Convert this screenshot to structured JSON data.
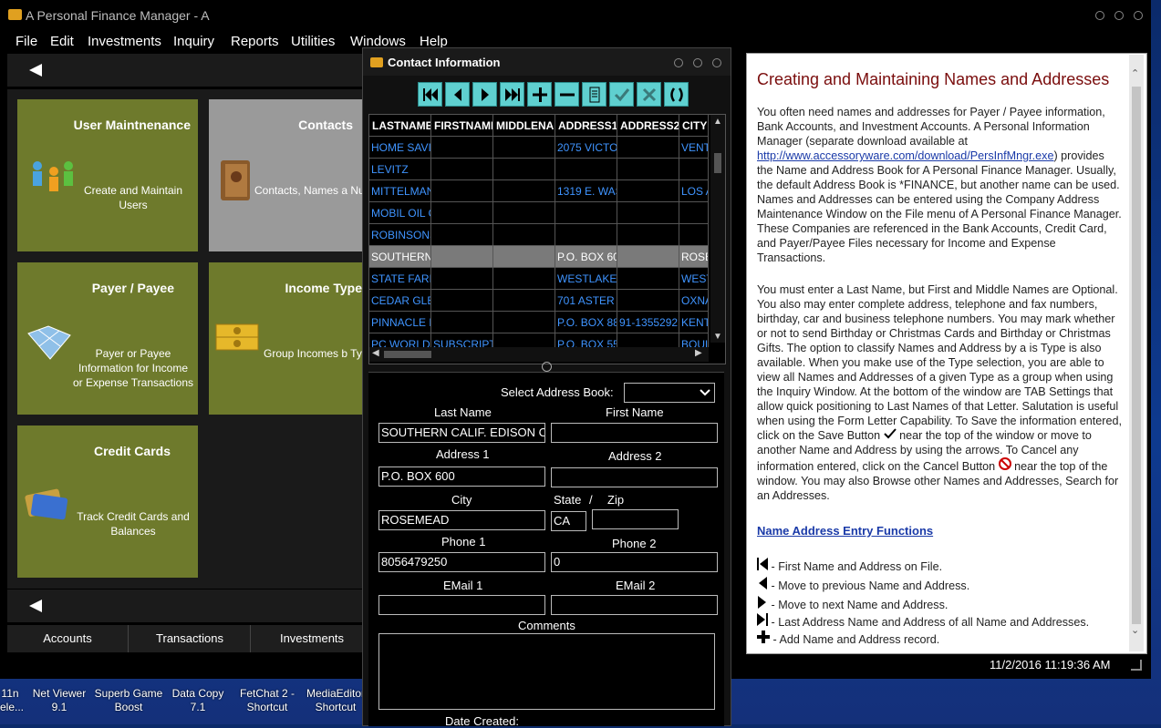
{
  "window": {
    "title": "A Personal Finance Manager - A"
  },
  "menu": [
    "File",
    "Edit",
    "Investments",
    "Inquiry",
    "Reports",
    "Utilities",
    "Windows",
    "Help"
  ],
  "tiles": [
    {
      "title": "User Maintnenance",
      "desc": "Create and Maintain Users",
      "icon": "users-icon"
    },
    {
      "title": "Contacts",
      "desc": "Contacts, Names a Numbers",
      "icon": "address-book-icon"
    },
    {
      "title": "Payer / Payee",
      "desc": "Payer or Payee Information for Income or Expense Transactions",
      "icon": "map-icon"
    },
    {
      "title": "Income Type",
      "desc": "Group Incomes b Types Created He",
      "icon": "money-icon"
    },
    {
      "title": "Credit Cards",
      "desc": "Track Credit Cards and Balances",
      "icon": "credit-card-icon"
    }
  ],
  "bottom_tabs": [
    "Accounts",
    "Transactions",
    "Investments"
  ],
  "status": {
    "datetime": "11/2/2016 11:19:36 AM"
  },
  "dialog": {
    "title": "Contact Information",
    "toolbar": [
      "first-record",
      "previous-record",
      "next-record",
      "last-record",
      "add-record",
      "delete-record",
      "print",
      "save",
      "cancel",
      "refresh"
    ],
    "grid": {
      "columns": [
        "LASTNAME",
        "FIRSTNAME",
        "MIDDLENAME",
        "ADDRESS1",
        "ADDRESS2",
        "CITY"
      ],
      "rows": [
        [
          "HOME SAVII",
          "",
          "",
          "2075 VICTOI",
          "",
          "VENT"
        ],
        [
          "LEVITZ",
          "",
          "",
          "",
          "",
          ""
        ],
        [
          "MITTELMAN",
          "",
          "",
          "1319 E. WAS",
          "",
          "LOS A"
        ],
        [
          "MOBIL OIL C",
          "",
          "",
          "",
          "",
          ""
        ],
        [
          "ROBINSONS",
          "",
          "",
          "",
          "",
          ""
        ],
        [
          "SOUTHERN",
          "",
          "",
          "P.O. BOX 60",
          "",
          "ROSE"
        ],
        [
          "STATE FARM",
          "",
          "",
          "WESTLAKE C",
          "",
          "WEST"
        ],
        [
          "CEDAR GLEN",
          "",
          "",
          "701 ASTER S",
          "",
          "OXNA"
        ],
        [
          "PINNACLE P",
          "",
          "",
          "P.O. BOX 88",
          "91-1355292",
          "KENT"
        ],
        [
          "PC WORLD",
          "SUBSCRIPTI",
          "",
          "P.O. BOX 55",
          "",
          "BOUL"
        ]
      ],
      "selected_row": 5
    },
    "form": {
      "select_address_book_label": "Select Address Book:",
      "select_address_book_value": "",
      "last_name_label": "Last Name",
      "last_name": "SOUTHERN CALIF. EDISON COM",
      "first_name_label": "First Name",
      "first_name": "",
      "address1_label": "Address 1",
      "address1": "P.O. BOX 600",
      "address2_label": "Address 2",
      "address2": "",
      "city_label": "City",
      "city": "ROSEMEAD",
      "state_label": "State",
      "state_sep": "/",
      "zip_label": "Zip",
      "state": "CA",
      "zip": "",
      "phone1_label": "Phone 1",
      "phone1": "8056479250",
      "phone2_label": "Phone 2",
      "phone2": "0",
      "email1_label": "EMail 1",
      "email1": "",
      "email2_label": "EMail 2",
      "email2": "",
      "comments_label": "Comments",
      "comments": "",
      "date_created_label": "Date Created:"
    }
  },
  "help": {
    "heading": "Creating and Maintaining Names and Addresses",
    "p1_before": "You often need names and addresses for Payer / Payee information, Bank Accounts, and Investment Accounts. A Personal Information Manager (separate download available at ",
    "p1_link": "http://www.accessoryware.com/download/PersInfMngr.exe",
    "p1_after": ") provides the Name and Address Book for  A Personal Finance Manager. Usually, the default Address Book is *FINANCE, but another name can be used. Names and Addresses can be entered using the Company Address Maintenance Window on the File menu of A Personal Finance Manager. These Companies are referenced in the Bank Accounts, Credit Card, and Payer/Payee Files necessary for Income and Expense Transactions.",
    "p2_a": "You must enter a Last Name, but First and Middle Names are Optional. You also may enter complete address, telephone and fax numbers, birthday, car and business telephone numbers. You may mark whether or not to send Birthday or Christmas Cards and Birthday or Christmas Gifts. The option to classify Names and Address by a is Type is also available. When you make use of the Type selection, you are able to view all Names and Addresses of a given Type as a group when using the Inquiry Window. At the bottom of the window are TAB Settings that allow quick positioning to Last Names of that Letter. Salutation is useful when using the Form Letter Capability. To Save the information entered, click on the Save Button",
    "p2_b": " near the top of the window or move to another Name and Address by using the arrows. To Cancel any information entered, click on the Cancel Button ",
    "p2_c": " near the top of the window. You may also Browse other Names and Addresses, Search for an Addresses.",
    "subheading": "Name Address Entry Functions",
    "functions": [
      "- First Name and Address on File.",
      "- Move to previous Name and Address.",
      "- Move to next Name and Address.",
      "- Last Address Name and Address of all Name and Addresses.",
      "- Add Name and Address record."
    ]
  },
  "desktop_icons": [
    {
      "line1": "11n",
      "line2": "ele..."
    },
    {
      "line1": "Net Viewer",
      "line2": "9.1"
    },
    {
      "line1": "Superb Game",
      "line2": "Boost"
    },
    {
      "line1": "Data Copy",
      "line2": "7.1"
    },
    {
      "line1": "FetChat 2 -",
      "line2": "Shortcut"
    },
    {
      "line1": "MediaEditor",
      "line2": "Shortcut"
    }
  ]
}
